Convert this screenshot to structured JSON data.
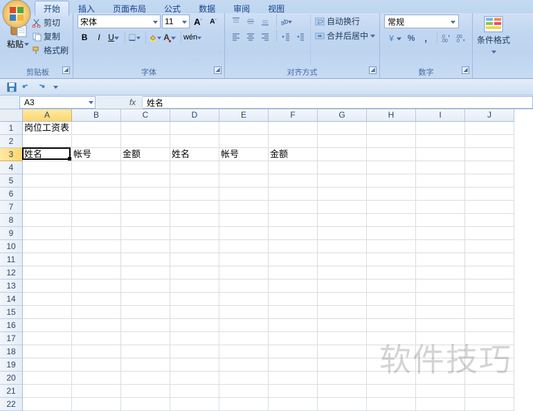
{
  "tabs": [
    "开始",
    "插入",
    "页面布局",
    "公式",
    "数据",
    "审阅",
    "视图"
  ],
  "active_tab": 0,
  "clipboard": {
    "paste": "粘贴",
    "cut": "剪切",
    "copy": "复制",
    "format_painter": "格式刷",
    "label": "剪贴板"
  },
  "font": {
    "name": "宋体",
    "size": "11",
    "label": "字体"
  },
  "align": {
    "wrap": "自动换行",
    "merge": "合并后居中",
    "label": "对齐方式"
  },
  "number": {
    "format": "常规",
    "label": "数字"
  },
  "styles": {
    "cond": "条件格式",
    "label": ""
  },
  "namebox": "A3",
  "fx_label": "fx",
  "formula_value": "姓名",
  "columns": [
    "A",
    "B",
    "C",
    "D",
    "E",
    "F",
    "G",
    "H",
    "I",
    "J"
  ],
  "row_count": 22,
  "selected_col": 0,
  "selected_row": 2,
  "cells": {
    "A1": "岗位工资表",
    "A3": "姓名",
    "B3": "帐号",
    "C3": "金额",
    "D3": "姓名",
    "E3": "帐号",
    "F3": "金额"
  },
  "watermark": "软件技巧"
}
